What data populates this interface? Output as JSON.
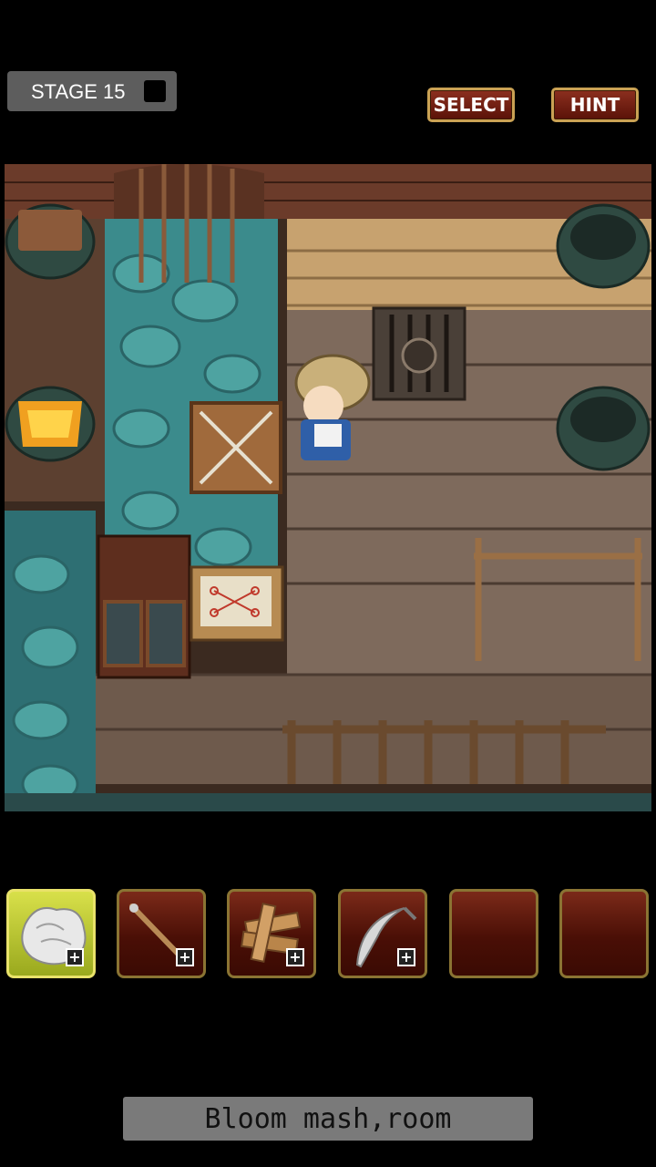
{
  "stage": {
    "label": "STAGE 15"
  },
  "buttons": {
    "select": "SELECT",
    "hint": "HINT"
  },
  "scene": {
    "braziers": [
      "empty-brazier",
      "lit-brazier",
      "empty-brazier",
      "empty-brazier"
    ],
    "objects": [
      "gate",
      "wooden-crate",
      "cabinet",
      "map-on-table",
      "wall-panel-emblem",
      "fence",
      "railing"
    ]
  },
  "inventory": [
    {
      "icon": "cloth-icon",
      "selected": true,
      "has_plus": true
    },
    {
      "icon": "stick-icon",
      "selected": false,
      "has_plus": true
    },
    {
      "icon": "planks-icon",
      "selected": false,
      "has_plus": true
    },
    {
      "icon": "sickle-icon",
      "selected": false,
      "has_plus": true
    },
    {
      "icon": "",
      "selected": false,
      "has_plus": false
    },
    {
      "icon": "",
      "selected": false,
      "has_plus": false
    }
  ],
  "inventory_plus_symbol": "+",
  "message": {
    "text": "Bloom mash,room"
  }
}
